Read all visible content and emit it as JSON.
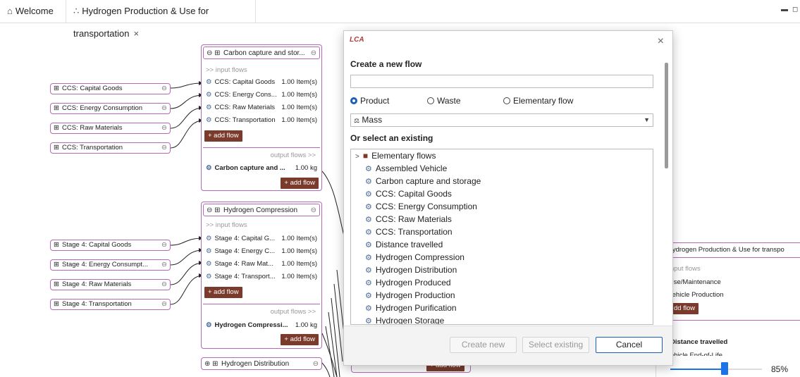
{
  "tabs": [
    {
      "label": "Welcome",
      "icon": "home-icon",
      "active": false
    },
    {
      "label": "Hydrogen Production & Use for transportation",
      "icon": "graph-icon",
      "active": true
    }
  ],
  "node_ccs": {
    "title": "Carbon capture and stor...",
    "input_label": ">> input flows",
    "inputs": [
      {
        "name": "CCS: Capital Goods",
        "amount": "1.00 Item(s)"
      },
      {
        "name": "CCS: Energy Cons...",
        "amount": "1.00 Item(s)"
      },
      {
        "name": "CCS: Raw Materials",
        "amount": "1.00 Item(s)"
      },
      {
        "name": "CCS: Transportation",
        "amount": "1.00 Item(s)"
      }
    ],
    "add_flow": "+ add flow",
    "output_label": "output flows >>",
    "output": {
      "name": "Carbon capture and ...",
      "amount": "1.00 kg"
    }
  },
  "node_h2c": {
    "title": "Hydrogen Compression",
    "input_label": ">> input flows",
    "inputs": [
      {
        "name": "Stage 4: Capital G...",
        "amount": "1.00 Item(s)"
      },
      {
        "name": "Stage 4: Energy C...",
        "amount": "1.00 Item(s)"
      },
      {
        "name": "Stage 4: Raw Mat...",
        "amount": "1.00 Item(s)"
      },
      {
        "name": "Stage 4: Transport...",
        "amount": "1.00 Item(s)"
      }
    ],
    "add_flow": "+ add flow",
    "output_label": "output flows >>",
    "output": {
      "name": "Hydrogen Compressi...",
      "amount": "1.00 kg"
    }
  },
  "node_dist": {
    "title": "Hydrogen Distribution"
  },
  "left_nodes": [
    "CCS: Capital Goods",
    "CCS: Energy Consumption",
    "CCS: Raw Materials",
    "CCS: Transportation",
    "Stage 4: Capital Goods",
    "Stage 4: Energy Consumpt...",
    "Stage 4: Raw Materials",
    "Stage 4: Transportation"
  ],
  "dialog": {
    "logo": "LCA",
    "title": "Create a new flow",
    "name_value": "",
    "radios": [
      {
        "label": "Product",
        "selected": true
      },
      {
        "label": "Waste",
        "selected": false
      },
      {
        "label": "Elementary flow",
        "selected": false
      }
    ],
    "property": "Mass",
    "existing_title": "Or select an existing",
    "tree_folder": "Elementary flows",
    "tree_items": [
      "Assembled Vehicle",
      "Carbon capture and storage",
      "CCS: Capital Goods",
      "CCS: Energy Consumption",
      "CCS: Raw Materials",
      "CCS: Transportation",
      "Distance travelled",
      "Hydrogen Compression",
      "Hydrogen Distribution",
      "Hydrogen Produced",
      "Hydrogen Production",
      "Hydrogen Purification",
      "Hydrogen Storage"
    ],
    "buttons": {
      "create": "Create new",
      "select": "Select existing",
      "cancel": "Cancel"
    }
  },
  "right_panel": {
    "node_title": "Hydrogen Production & Use for transpo",
    "input_label": "nput flows",
    "inputs": [
      "Jse/Maintenance",
      "/ehicle Production"
    ],
    "add_flow": "dd flow",
    "output": "Distance travelled",
    "output_partial": "ehicle End-of-Life"
  },
  "bottom_add_flow": "+ add flow",
  "zoom": {
    "label": "85%",
    "value": 85
  }
}
